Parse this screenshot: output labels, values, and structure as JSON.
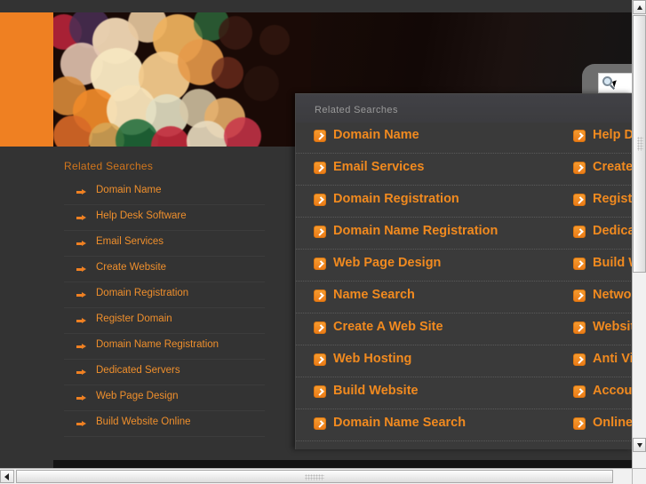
{
  "colors": {
    "accent_orange": "#ef8022",
    "link_orange": "#f18a1f",
    "sidebar_link": "#ef8f2c",
    "page_bg": "#333333",
    "overlay_bg": "#3a3a3a",
    "overlay_title": "#9a9a9a"
  },
  "sidebar": {
    "title": "Related Searches",
    "items": [
      {
        "label": "Domain Name"
      },
      {
        "label": "Help Desk Software"
      },
      {
        "label": "Email Services"
      },
      {
        "label": "Create Website"
      },
      {
        "label": "Domain Registration"
      },
      {
        "label": "Register Domain"
      },
      {
        "label": "Domain Name Registration"
      },
      {
        "label": "Dedicated Servers"
      },
      {
        "label": "Web Page Design"
      },
      {
        "label": "Build Website Online"
      }
    ]
  },
  "search": {
    "value": "",
    "placeholder": "",
    "icon": "search-icon"
  },
  "overlay": {
    "title": "Related Searches",
    "rows": [
      {
        "left": "Domain Name",
        "right": "Help Desk Software"
      },
      {
        "left": "Email Services",
        "right": "Create Website"
      },
      {
        "left": "Domain Registration",
        "right": "Register Domain"
      },
      {
        "left": "Domain Name Registration",
        "right": "Dedicated Servers"
      },
      {
        "left": "Web Page Design",
        "right": "Build Website Online"
      },
      {
        "left": "Name Search",
        "right": "Network Monitoring"
      },
      {
        "left": "Create A Web Site",
        "right": "Website Hosting"
      },
      {
        "left": "Web Hosting",
        "right": "Anti Virus Software"
      },
      {
        "left": "Build Website",
        "right": "Accounting Software"
      },
      {
        "left": "Domain Name Search",
        "right": "Online Training"
      }
    ]
  },
  "scrollbars": {
    "vertical": {
      "up": "▲",
      "down": "▼"
    },
    "horizontal": {
      "left": "◀"
    }
  }
}
